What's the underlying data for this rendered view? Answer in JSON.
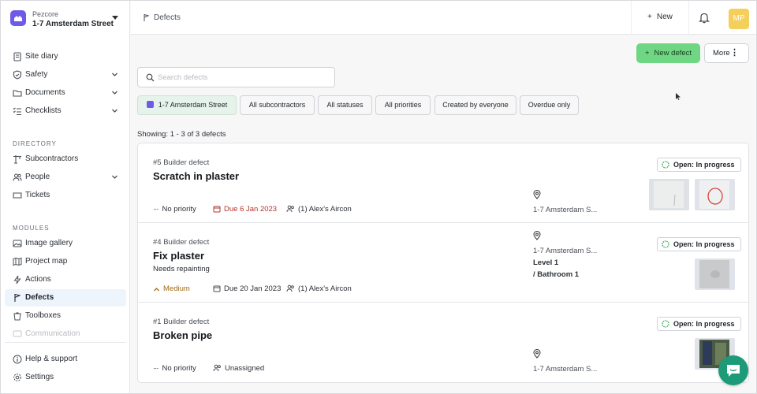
{
  "sidebar": {
    "org_name": "Pezcore",
    "site_name": "1-7 Amsterdam Street",
    "top_items": [
      {
        "label": "Site diary",
        "icon": "notebook-icon"
      },
      {
        "label": "Safety",
        "icon": "shield-icon"
      },
      {
        "label": "Documents",
        "icon": "folder-icon"
      },
      {
        "label": "Checklists",
        "icon": "checklist-icon"
      }
    ],
    "directory_label": "DIRECTORY",
    "directory_items": [
      {
        "label": "Subcontractors",
        "icon": "crane-icon"
      },
      {
        "label": "People",
        "icon": "people-icon"
      },
      {
        "label": "Tickets",
        "icon": "ticket-icon"
      }
    ],
    "modules_label": "MODULES",
    "module_items": [
      {
        "label": "Image gallery",
        "icon": "image-icon"
      },
      {
        "label": "Project map",
        "icon": "map-icon"
      },
      {
        "label": "Actions",
        "icon": "lightning-icon"
      },
      {
        "label": "Defects",
        "icon": "flag-icon",
        "active": true
      },
      {
        "label": "Toolboxes",
        "icon": "toolbox-icon"
      },
      {
        "label": "Communication",
        "icon": "message-icon"
      }
    ],
    "bottom_items": [
      {
        "label": "Help & support",
        "icon": "help-icon"
      },
      {
        "label": "Settings",
        "icon": "gear-icon"
      }
    ]
  },
  "topbar": {
    "breadcrumb": "Defects",
    "new_label": "New",
    "avatar_initials": "MP"
  },
  "actions": {
    "new_defect_label": "New defect",
    "more_label": "More"
  },
  "search": {
    "placeholder": "Search defects",
    "value": ""
  },
  "filters": [
    "1-7 Amsterdam Street",
    "All subcontractors",
    "All statuses",
    "All priorities",
    "Created by everyone",
    "Overdue only"
  ],
  "showing_text": "Showing: 1 - 3 of 3 defects",
  "defects": [
    {
      "ref": "#5 Builder defect",
      "title": "Scratch in plaster",
      "description": "",
      "priority": "No priority",
      "due": "Due 6 Jan 2023",
      "overdue": true,
      "assignee": "(1)  Alex's Aircon",
      "location": "1-7 Amsterdam S...",
      "location_lines": [],
      "status": "Open: In progress",
      "thumbnails": 2
    },
    {
      "ref": "#4 Builder defect",
      "title": "Fix plaster",
      "description": "Needs repainting",
      "priority": "Medium",
      "due": "Due 20 Jan 2023",
      "overdue": false,
      "assignee": "(1)  Alex's Aircon",
      "location": "1-7 Amsterdam S...",
      "location_lines": [
        "Level 1",
        "/ Bathroom 1"
      ],
      "status": "Open: In progress",
      "thumbnails": 1
    },
    {
      "ref": "#1 Builder defect",
      "title": "Broken pipe",
      "description": "",
      "priority": "No priority",
      "due": "",
      "overdue": false,
      "assignee": "Unassigned",
      "location": "1-7 Amsterdam S...",
      "location_lines": [],
      "status": "Open: In progress",
      "thumbnails": 1
    }
  ],
  "colors": {
    "accent_green": "#6fd684",
    "brand_purple": "#6e5ce8",
    "overdue_red": "#b4342a",
    "medium_amber": "#a06a12",
    "chat_green": "#1d9b78"
  }
}
